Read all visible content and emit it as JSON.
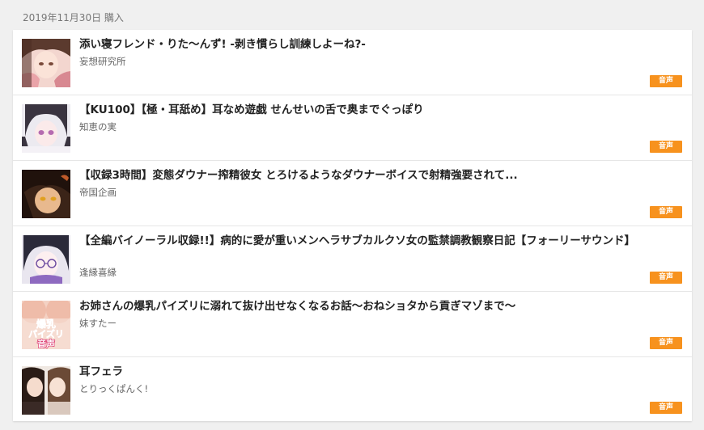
{
  "purchase_date": "2019年11月30日 購入",
  "colors": {
    "badge": "#f7921e"
  },
  "items": [
    {
      "title": "添い寝フレンド・りた〜んず! -剥き慣らし訓練しよーね?-",
      "circle": "妄想研究所",
      "badge": "音声",
      "cover_icon": "cover-art-icon"
    },
    {
      "title": "【KU100】【極・耳舐め】耳なめ遊戯 せんせいの舌で奥までぐっぽり",
      "circle": "知恵の実",
      "badge": "音声",
      "cover_icon": "cover-art-icon"
    },
    {
      "title": "【収録3時間】変態ダウナー搾精彼女 とろけるようなダウナーボイスで射精強要されて...",
      "circle": "帝国企画",
      "badge": "音声",
      "cover_icon": "cover-art-icon"
    },
    {
      "title": "【全編バイノーラル収録!!】病的に愛が重いメンヘラサブカルクソ女の監禁調教観察日記【フォーリーサウンド】",
      "circle": "逢縁喜縁",
      "badge": "音声",
      "cover_icon": "cover-art-icon"
    },
    {
      "title": "お姉さんの爆乳パイズリに溺れて抜け出せなくなるお話〜おねショタから貢ぎマゾまで〜",
      "circle": "妹すたー",
      "badge": "音声",
      "cover_icon": "cover-art-icon",
      "cover_text": [
        "爆乳",
        "パイズリ",
        "音声"
      ]
    },
    {
      "title": "耳フェラ",
      "circle": "とりっくぱんく!",
      "badge": "音声",
      "cover_icon": "cover-art-icon"
    }
  ]
}
